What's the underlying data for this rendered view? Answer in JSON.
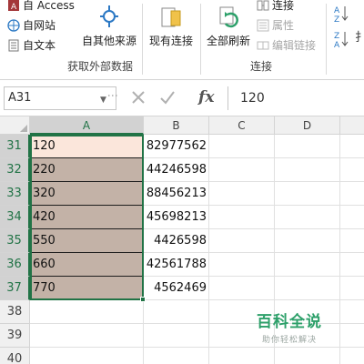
{
  "ribbon": {
    "access_label": "自 Access",
    "web_label": "自网站",
    "text_label": "自文本",
    "other_sources_label": "自其他来源",
    "existing_conn_label": "现有连接",
    "refresh_all_label": "全部刷新",
    "connections_label": "连接",
    "properties_label": "属性",
    "edit_links_label": "编辑链接",
    "group_external_data": "获取外部数据",
    "group_connections": "连接"
  },
  "formula_bar": {
    "name_box": "A31",
    "value": "120",
    "fx_label": "fx"
  },
  "grid": {
    "columns": [
      "A",
      "B",
      "C",
      "D"
    ],
    "rows": [
      {
        "num": "31",
        "a": "120",
        "b": "82977562"
      },
      {
        "num": "32",
        "a": "220",
        "b": "44246598"
      },
      {
        "num": "33",
        "a": "320",
        "b": "88456213"
      },
      {
        "num": "34",
        "a": "420",
        "b": "45698213"
      },
      {
        "num": "35",
        "a": "550",
        "b": "4426598"
      },
      {
        "num": "36",
        "a": "660",
        "b": "42561788"
      },
      {
        "num": "37",
        "a": "770",
        "b": "4562469"
      },
      {
        "num": "38",
        "a": "",
        "b": ""
      },
      {
        "num": "39",
        "a": "",
        "b": ""
      },
      {
        "num": "40",
        "a": "",
        "b": ""
      }
    ]
  },
  "watermark": {
    "title": "百科全说",
    "subtitle": "助你轻松解决"
  },
  "colors": {
    "accent": "#217346",
    "selection_fill": "#c3b2a7",
    "active_cell_fill": "#fbe6db",
    "watermark": "#2da06a"
  }
}
